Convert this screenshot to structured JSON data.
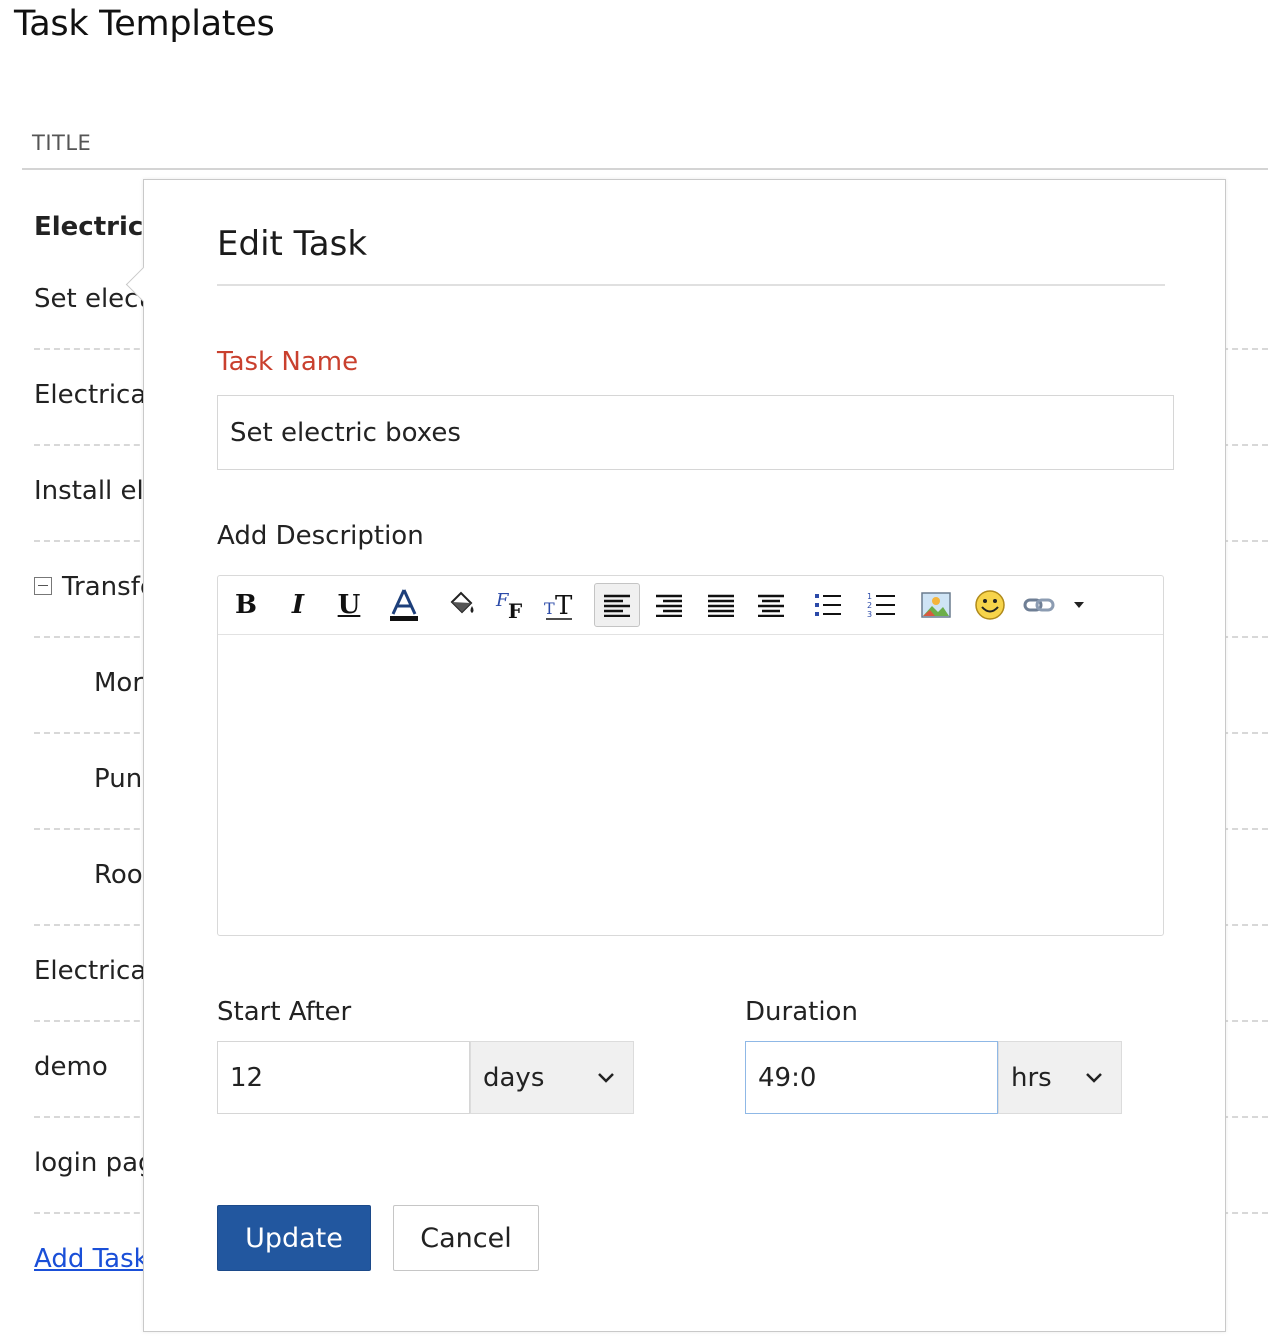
{
  "page": {
    "title": "Task Templates",
    "column_header": "TITLE"
  },
  "background_list": {
    "rows": [
      {
        "text": "Electrici"
      },
      {
        "text": "Set elect"
      },
      {
        "text": "Electrical"
      },
      {
        "text": "Install ele"
      },
      {
        "text": "Transfe"
      },
      {
        "text": "Mor"
      },
      {
        "text": "Pun"
      },
      {
        "text": "Roo"
      },
      {
        "text": "Electrical"
      },
      {
        "text": "demo"
      },
      {
        "text": "login pag"
      },
      {
        "text": "Add Task"
      }
    ]
  },
  "modal": {
    "title": "Edit Task",
    "task_name": {
      "label": "Task Name",
      "value": "Set electric boxes"
    },
    "description": {
      "label": "Add Description",
      "value": "",
      "toolbar": [
        "bold-icon",
        "italic-icon",
        "underline-icon",
        "font-color-icon",
        "background-color-icon",
        "font-family-icon",
        "font-size-icon",
        "align-left-icon",
        "align-right-icon",
        "justify-icon",
        "align-center-icon",
        "bulleted-list-icon",
        "numbered-list-icon",
        "insert-image-icon",
        "emoji-icon",
        "insert-link-icon",
        "more-options-icon"
      ],
      "active_tool": "align-left-icon"
    },
    "start_after": {
      "label": "Start After",
      "value": "12",
      "unit": "days"
    },
    "duration": {
      "label": "Duration",
      "value": "49:0",
      "unit": "hrs"
    },
    "buttons": {
      "update": "Update",
      "cancel": "Cancel"
    }
  },
  "colors": {
    "required_label": "#c9402e",
    "primary_button": "#22579f",
    "link": "#1a4fd8",
    "focus_border": "#8fb8e6"
  }
}
